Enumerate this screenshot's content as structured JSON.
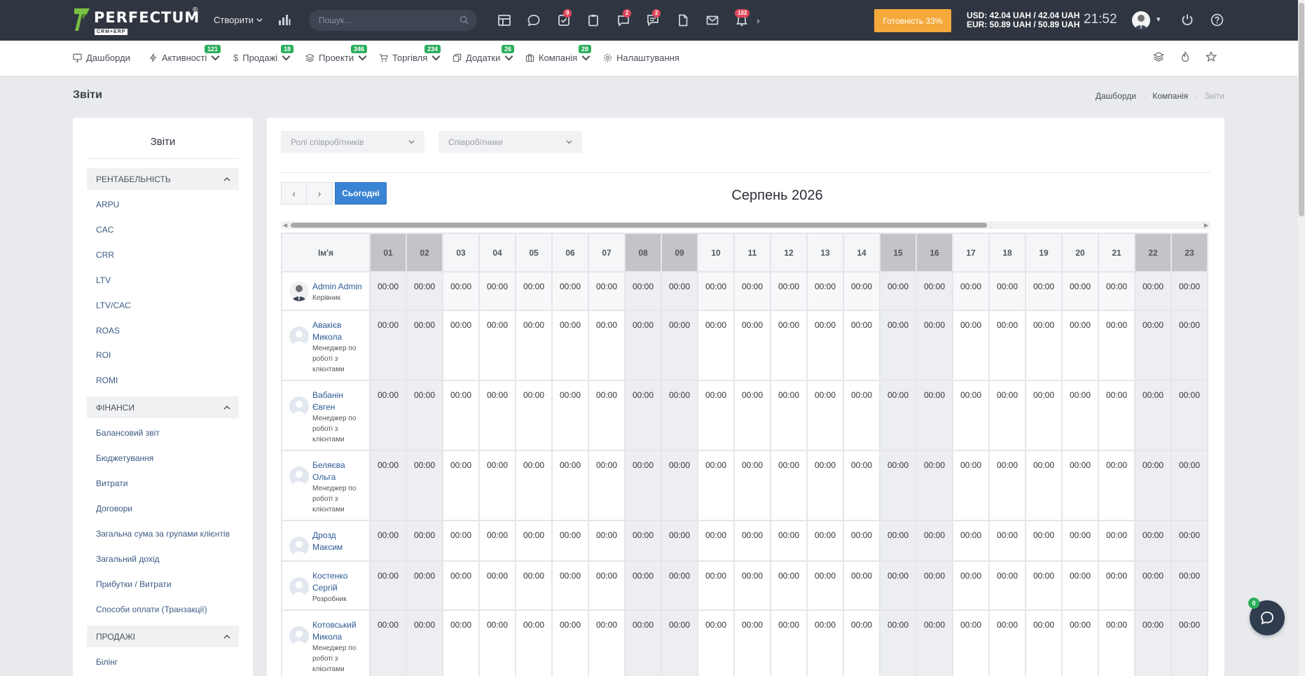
{
  "topbar": {
    "logo_name": "PERFECTUM",
    "logo_sub": "CRM+ERP",
    "logo_reg": "®",
    "create_label": "Створити",
    "search_placeholder": "Пошук...",
    "icon_badges": {
      "tasks": "9",
      "comments": "2",
      "messages": "2",
      "notifications": "102"
    },
    "ready_label": "Готовність 33%",
    "rates_usd": "USD: 42.04 UAH / 42.04 UAH",
    "rates_eur": "EUR: 50.89 UAH / 50.89 UAH",
    "clock": "21:52",
    "accent_color": "#f5a93a"
  },
  "nav": {
    "items": [
      {
        "label": "Дашборди",
        "badge": ""
      },
      {
        "label": "Активності",
        "badge": "121"
      },
      {
        "label": "Продажі",
        "badge": "18"
      },
      {
        "label": "Проекти",
        "badge": "346"
      },
      {
        "label": "Торгівля",
        "badge": "234"
      },
      {
        "label": "Додатки",
        "badge": "26"
      },
      {
        "label": "Компанія",
        "badge": "28"
      },
      {
        "label": "Налаштування",
        "badge": ""
      }
    ]
  },
  "page": {
    "title": "Звіти",
    "breadcrumb": [
      "Дашборди",
      "Компанія",
      "Звіти"
    ]
  },
  "sidebar": {
    "title": "Звіти",
    "sections": [
      {
        "label": "РЕНТАБЕЛЬНІСТЬ",
        "items": [
          "ARPU",
          "CAC",
          "CRR",
          "LTV",
          "LTV/CAC",
          "ROAS",
          "ROI",
          "ROMI"
        ]
      },
      {
        "label": "ФІНАНСИ",
        "items": [
          "Балансовий звіт",
          "Бюджетування",
          "Витрати",
          "Договори",
          "Загальна сума за групами клієнтів",
          "Загальний дохід",
          "Прибутки / Витрати",
          "Способи оплати (Транзакції)"
        ]
      },
      {
        "label": "ПРОДАЖІ",
        "items": [
          "Білінг"
        ]
      }
    ]
  },
  "filters": {
    "roles_placeholder": "Ролі співробітників",
    "employees_placeholder": "Співробітники"
  },
  "calendar": {
    "today_label": "Сьогодні",
    "prev_label": "‹",
    "next_label": "›",
    "title": "Серпень 2026",
    "name_header": "Ім'я",
    "days": [
      "01",
      "02",
      "03",
      "04",
      "05",
      "06",
      "07",
      "08",
      "09",
      "10",
      "11",
      "12",
      "13",
      "14",
      "15",
      "16",
      "17",
      "18",
      "19",
      "20",
      "21",
      "22",
      "23"
    ],
    "weekend_days": [
      "01",
      "02",
      "08",
      "09",
      "15",
      "16",
      "22",
      "23"
    ],
    "cell_value": "00:00",
    "employees": [
      {
        "name": "Admin Admin",
        "role": "Керівник"
      },
      {
        "name": "Авакієв Микола",
        "role": "Менеджер по роботі з клієнтами"
      },
      {
        "name": "Вабанін Євген",
        "role": "Менеджер по роботі з клієнтами"
      },
      {
        "name": "Беляєва Ольга",
        "role": "Менеджер по роботі з клієнтами"
      },
      {
        "name": "Дрозд Максим",
        "role": ""
      },
      {
        "name": "Костенко Сергій",
        "role": "Розробник"
      },
      {
        "name": "Котовський Микола",
        "role": "Менеджер по роботі з клієнтами"
      }
    ]
  },
  "chat": {
    "badge": "0"
  }
}
